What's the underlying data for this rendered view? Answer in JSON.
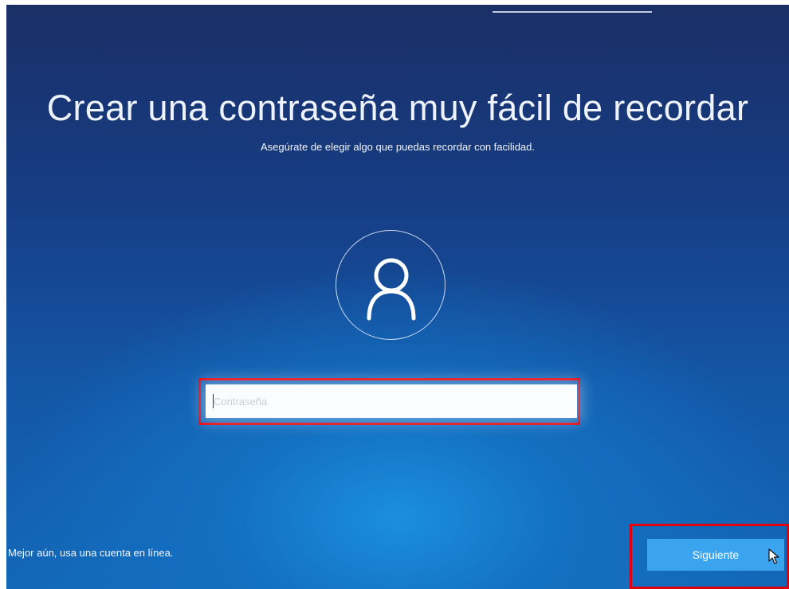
{
  "setup": {
    "title": "Crear una contraseña muy fácil de recordar",
    "subtitle": "Asegúrate de elegir algo que puedas recordar con facilidad."
  },
  "password": {
    "placeholder": "Contraseña",
    "value": ""
  },
  "footer": {
    "online_account_link": "Mejor aún, usa una cuenta en línea.",
    "next_button_label": "Siguiente"
  },
  "colors": {
    "annotation_highlight": "#e2000f",
    "button_accent": "#3aa4ee"
  },
  "icons": {
    "avatar": "user-icon",
    "pointer": "mouse-cursor-icon"
  }
}
